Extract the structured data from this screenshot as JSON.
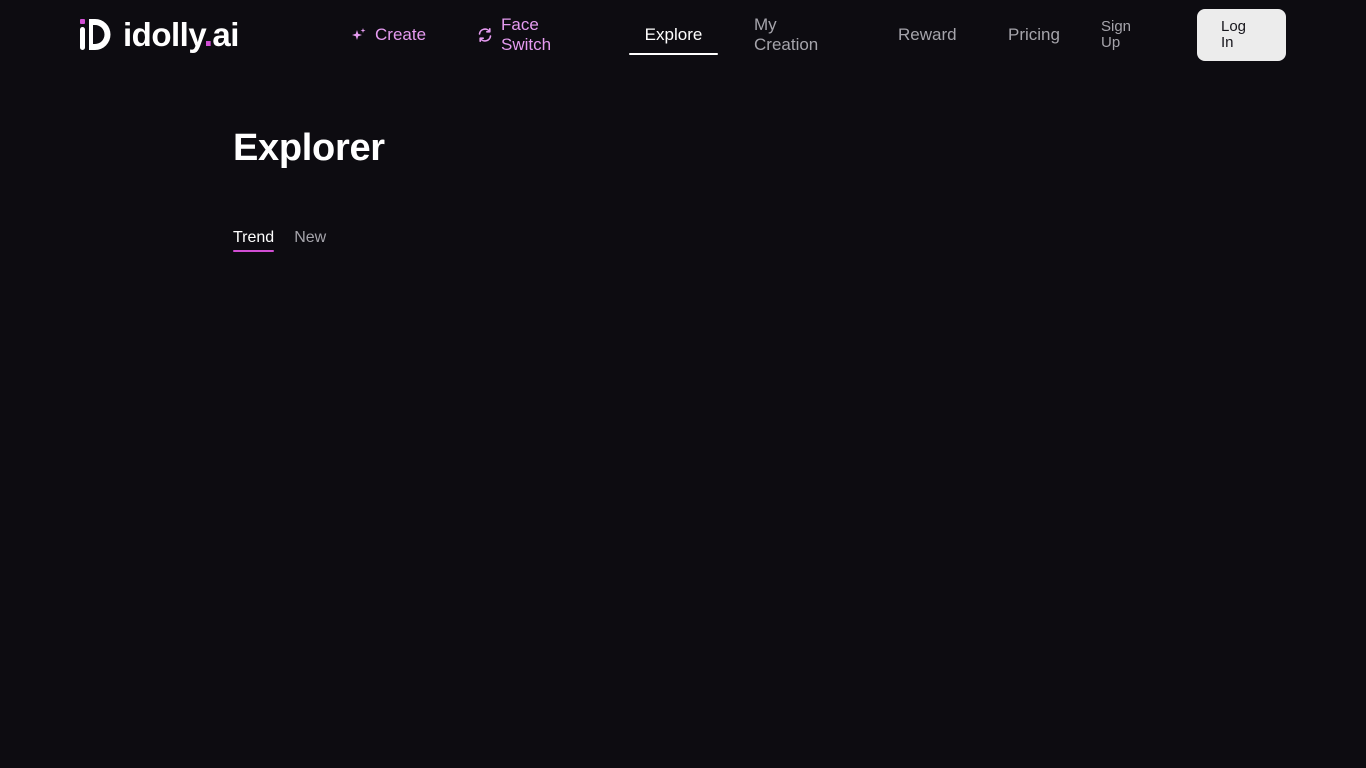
{
  "header": {
    "logo": {
      "text_main": "idolly",
      "text_dot": ".",
      "text_suffix": "ai"
    },
    "nav": {
      "create": "Create",
      "face_switch": "Face Switch",
      "explore": "Explore",
      "my_creation": "My Creation",
      "reward": "Reward",
      "pricing": "Pricing",
      "sign_up": "Sign Up"
    },
    "login_label": "Log In",
    "icons": {
      "create": "sparkle-icon",
      "face_switch": "refresh-icon"
    }
  },
  "main": {
    "title": "Explorer",
    "tabs": [
      {
        "label": "Trend",
        "active": true
      },
      {
        "label": "New",
        "active": false
      }
    ]
  },
  "colors": {
    "background": "#0d0c11",
    "accent": "#d14ed4",
    "accent_text": "#e59bf0",
    "nav_text": "#a5a4ab",
    "login_bg": "#ececec"
  }
}
